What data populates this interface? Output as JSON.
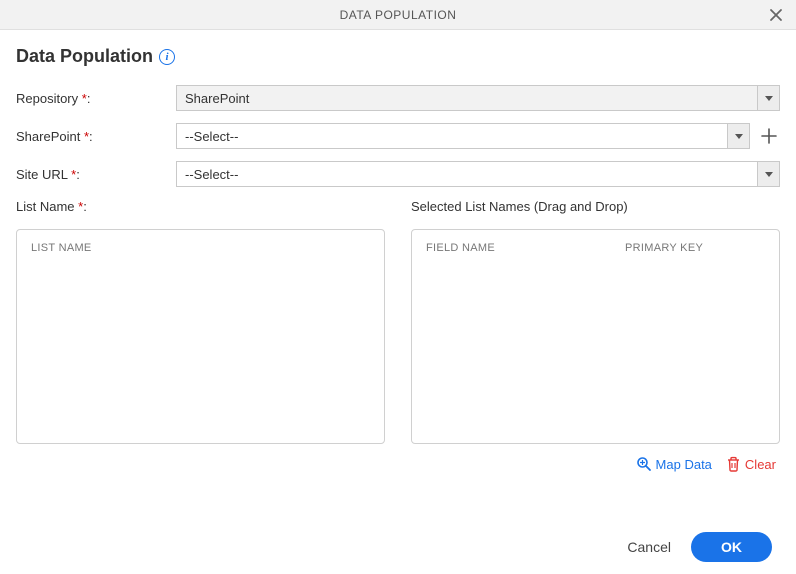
{
  "modal": {
    "header_title": "DATA POPULATION",
    "title": "Data Population"
  },
  "form": {
    "repository": {
      "label": "Repository ",
      "required": "*",
      "colon": ":",
      "value": "SharePoint"
    },
    "sharepoint": {
      "label": "SharePoint ",
      "required": "*",
      "colon": ":",
      "value": "--Select--"
    },
    "site_url": {
      "label": "Site URL ",
      "required": "*",
      "colon": ":",
      "value": "--Select--"
    }
  },
  "lists": {
    "left": {
      "label": "List Name ",
      "required": "*",
      "colon": ":",
      "header_col1": "LIST NAME"
    },
    "right": {
      "label": "Selected List Names (Drag and Drop)",
      "header_col1": "FIELD NAME",
      "header_col2": "PRIMARY KEY"
    }
  },
  "actions": {
    "map_data": "Map Data",
    "clear": "Clear"
  },
  "footer": {
    "cancel": "Cancel",
    "ok": "OK"
  }
}
